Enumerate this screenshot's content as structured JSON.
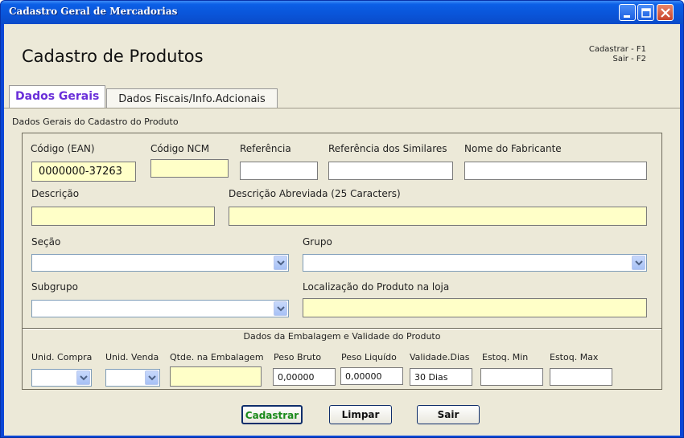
{
  "window": {
    "title": "Cadastro Geral de Mercadorias",
    "buttons": [
      "minimize",
      "maximize",
      "close"
    ]
  },
  "header": {
    "title": "Cadastro de Produtos",
    "shortcut_register": "Cadastrar - F1",
    "shortcut_exit": "Sair - F2"
  },
  "tabs": [
    {
      "label": "Dados Gerais",
      "active": true
    },
    {
      "label": "Dados Fiscais/Info.Adcionais",
      "active": false
    }
  ],
  "form": {
    "group_caption": "Dados Gerais do Cadastro do Produto",
    "fields": {
      "codigo_ean": {
        "label": "Código (EAN)",
        "value": "0000000-37263"
      },
      "codigo_ncm": {
        "label": "Código NCM",
        "value": ""
      },
      "referencia": {
        "label": "Referência",
        "value": ""
      },
      "referencia_similares": {
        "label": "Referência dos Similares",
        "value": ""
      },
      "nome_fabricante": {
        "label": "Nome do Fabricante",
        "value": ""
      },
      "descricao": {
        "label": "Descrição",
        "value": ""
      },
      "descricao_abreviada": {
        "label": "Descrição Abreviada (25 Caracters)",
        "value": ""
      },
      "secao": {
        "label": "Seção",
        "value": ""
      },
      "grupo": {
        "label": "Grupo",
        "value": ""
      },
      "subgrupo": {
        "label": "Subgrupo",
        "value": ""
      },
      "localizacao": {
        "label": "Localização do Produto na loja",
        "value": ""
      }
    },
    "packaging": {
      "caption": "Dados da Embalagem e Validade do Produto",
      "unid_compra": {
        "label": "Unid. Compra",
        "value": ""
      },
      "unid_venda": {
        "label": "Unid. Venda",
        "value": ""
      },
      "qtde_embalagem": {
        "label": "Qtde. na Embalagem",
        "value": ""
      },
      "peso_bruto": {
        "label": "Peso Bruto",
        "value": "0,00000"
      },
      "peso_liquido": {
        "label": "Peso Liquído",
        "value": "0,00000"
      },
      "validade_dias": {
        "label": "Validade.Dias",
        "value": "30 Dias"
      },
      "estoq_min": {
        "label": "Estoq. Min",
        "value": ""
      },
      "estoq_max": {
        "label": "Estoq. Max",
        "value": ""
      }
    }
  },
  "actions": {
    "cadastrar": "Cadastrar",
    "limpar": "Limpar",
    "sair": "Sair"
  },
  "colors": {
    "titlebar": "#0a54d8",
    "client_bg": "#ece9d8",
    "field_highlight": "#ffffc8",
    "active_tab_text": "#6a2fd9",
    "cadastrar_text": "#1a8a1a"
  }
}
